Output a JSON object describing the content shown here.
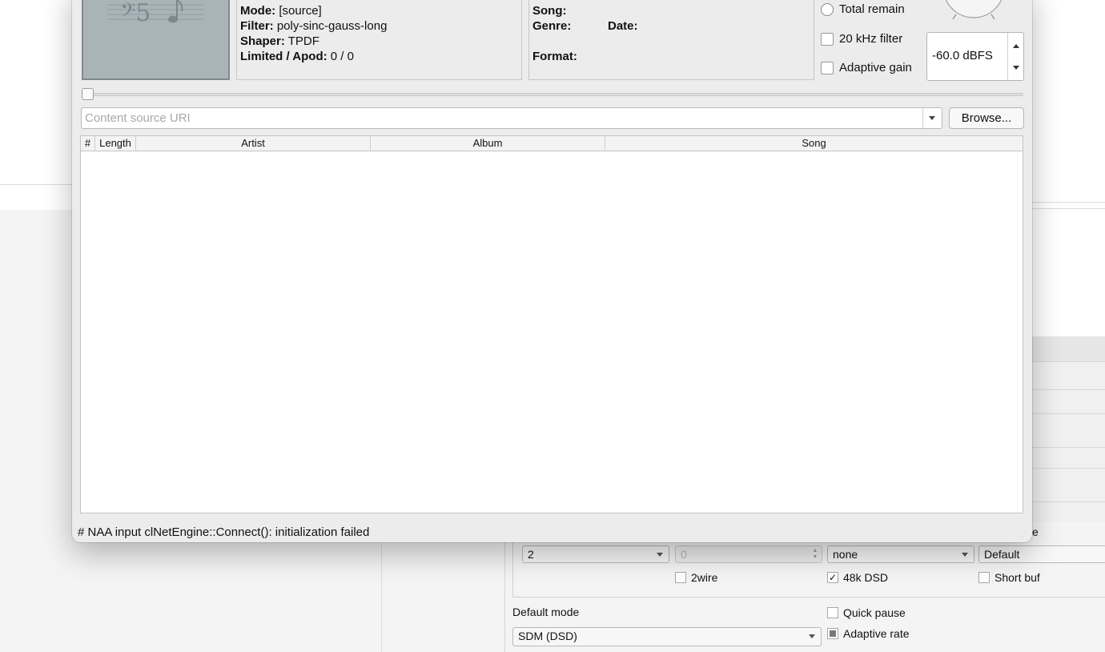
{
  "player": {
    "info": {
      "mode_label": "Mode:",
      "mode_value": "[source]",
      "filter_label": "Filter:",
      "filter_value": "poly-sinc-gauss-long",
      "shaper_label": "Shaper:",
      "shaper_value": "TPDF",
      "limited_label": "Limited / Apod:",
      "limited_value": "0 / 0"
    },
    "meta": {
      "song_label": "Song:",
      "genre_label": "Genre:",
      "date_label": "Date:",
      "format_label": "Format:"
    },
    "controls": {
      "total_remain": "Total remain",
      "filter_20khz": "20 kHz filter",
      "adaptive_gain": "Adaptive gain",
      "volume_value": "-60.0 dBFS"
    },
    "source": {
      "placeholder": "Content source URI",
      "browse_label": "Browse..."
    },
    "playlist": {
      "columns": [
        "#",
        "Length",
        "Artist",
        "Album",
        "Song"
      ],
      "rows": []
    },
    "status": "# NAA input clNetEngine::Connect(): initialization failed"
  },
  "settings": {
    "row_combo_1": "2",
    "row_spin": "0",
    "row_combo_3": "none",
    "row_combo_4": "Default",
    "truncated_label": "e",
    "chk_2wire": "2wire",
    "chk_48k": "48k DSD",
    "chk_shortbuf": "Short buf",
    "default_mode_label": "Default mode",
    "default_mode_value": "SDM (DSD)",
    "chk_quick_pause": "Quick pause",
    "chk_adaptive_rate": "Adaptive rate"
  },
  "colors": {
    "window_bg": "#ececec",
    "cover_bg": "#a9b4b9"
  }
}
